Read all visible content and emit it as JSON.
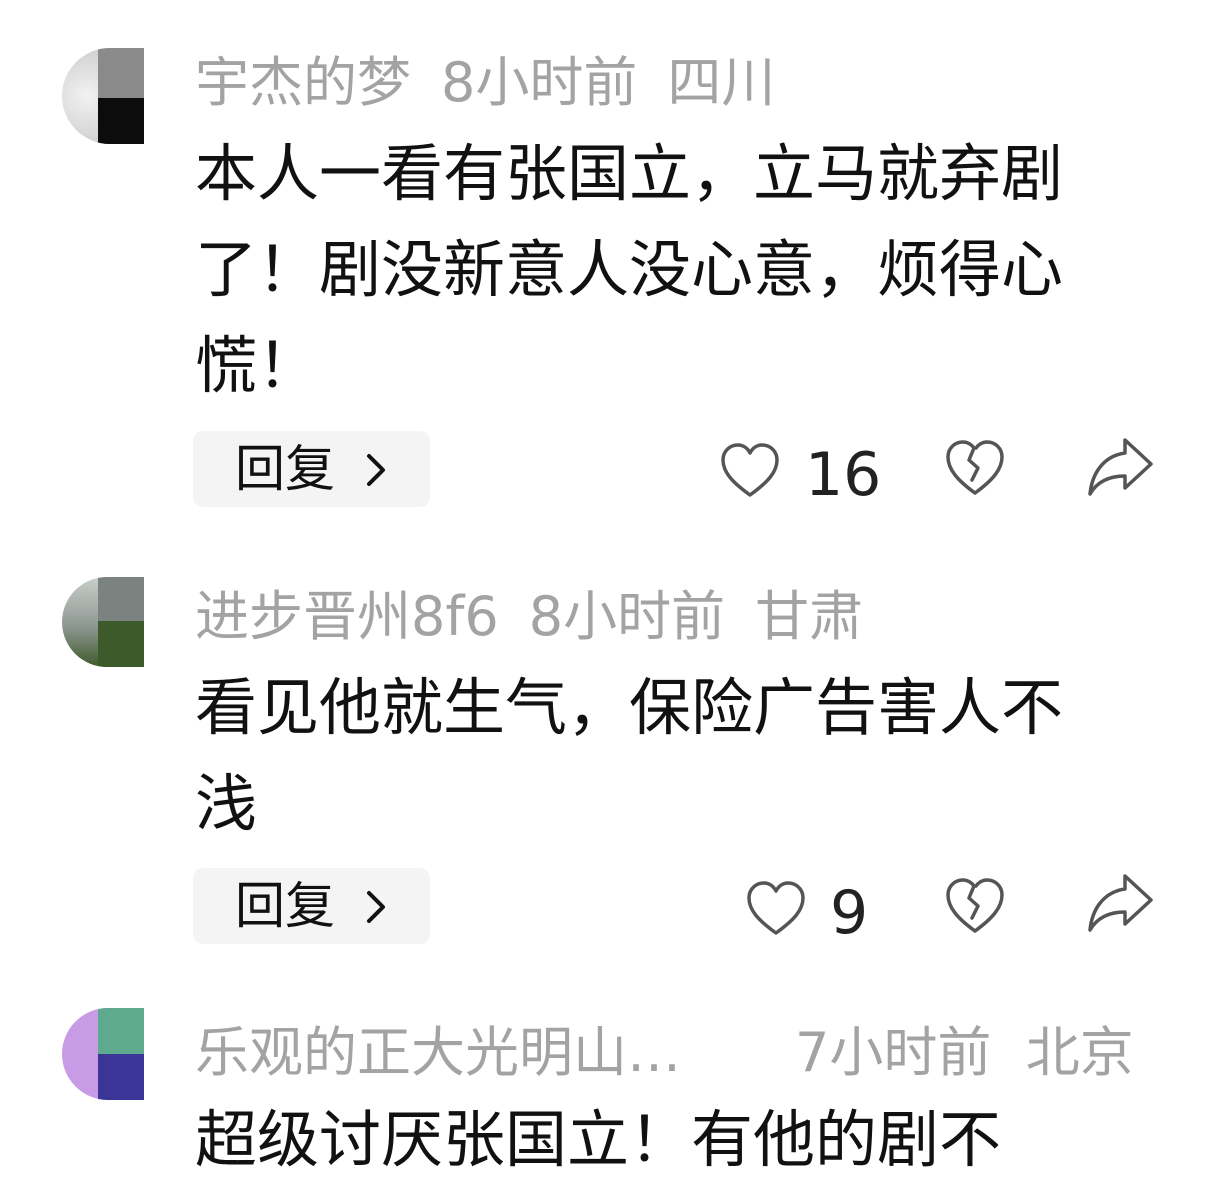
{
  "comments": [
    {
      "username": "宇杰的梦",
      "time": "8小时前",
      "location": "四川",
      "text_lines": [
        "本人一看有张国立，立马就弃剧",
        "了！剧没新意人没心意，烦得心",
        "慌！"
      ],
      "reply_label": "回复",
      "likes": "16",
      "avatar_colors": [
        "#d9d9d9",
        "#8a8a8a",
        "#0c0c0c"
      ]
    },
    {
      "username": "进步晋州8f6",
      "time": "8小时前",
      "location": "甘肃",
      "text_lines": [
        "看见他就生气，保险广告害人不",
        "浅"
      ],
      "reply_label": "回复",
      "likes": "9",
      "avatar_colors": [
        "#9aa39c",
        "#7b8381",
        "#3d5a2a"
      ]
    },
    {
      "username": "乐观的正大光明山…",
      "time": "7小时前",
      "location": "北京",
      "text_lines": [
        "超级讨厌张国立！有他的剧不"
      ],
      "avatar_colors": [
        "#c89be6",
        "#5fa98e",
        "#3a3596"
      ]
    }
  ],
  "icons": {
    "like": "heart-outline-icon",
    "dislike": "broken-heart-icon",
    "share": "share-arrow-icon",
    "chevron": "chevron-right-icon"
  },
  "colors": {
    "meta": "#a3a3a3",
    "text": "#111111",
    "reply_bg": "#f4f4f4",
    "icon": "#555555"
  }
}
